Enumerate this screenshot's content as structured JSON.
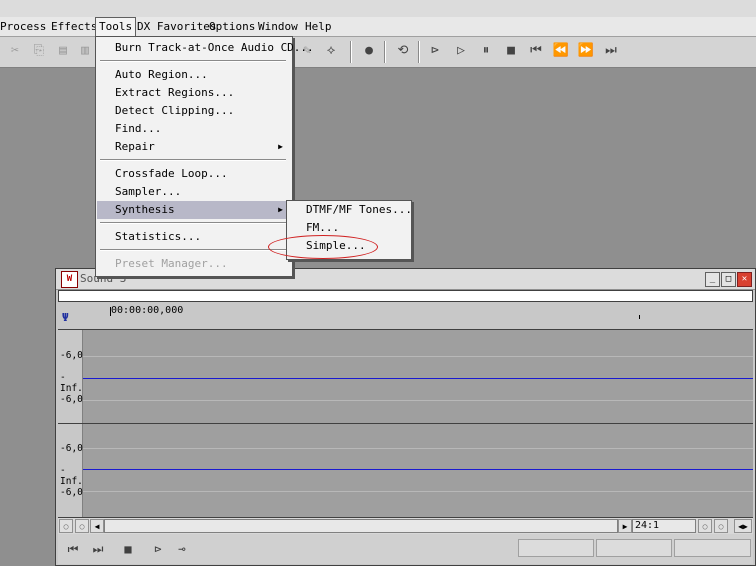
{
  "menu": [
    {
      "label": "Process",
      "active": false
    },
    {
      "label": "Effects",
      "active": false
    },
    {
      "label": "Tools",
      "active": true
    },
    {
      "label": "DX Favorites",
      "active": false
    },
    {
      "label": "Options",
      "active": false
    },
    {
      "label": "Window",
      "active": false
    },
    {
      "label": "Help",
      "active": false
    }
  ],
  "tools_menu": {
    "burn": "Burn Track-at-Once Audio CD...",
    "auto_region": "Auto Region...",
    "extract_regions": "Extract Regions...",
    "detect_clipping": "Detect Clipping...",
    "find": "Find...",
    "repair": "Repair",
    "crossfade_loop": "Crossfade Loop...",
    "sampler": "Sampler...",
    "synthesis": "Synthesis",
    "statistics": "Statistics...",
    "preset_manager": "Preset Manager..."
  },
  "synthesis_submenu": {
    "dtmf": "DTMF/MF Tones...",
    "fm": "FM...",
    "simple": "Simple..."
  },
  "sound_window": {
    "title": "Sound 3",
    "timecode": "00:00:00,000",
    "zoom": "24:1",
    "channel1_labels": [
      "-6,0",
      "-Inf.",
      "-6,0"
    ],
    "channel2_labels": [
      "-6,0",
      "-Inf.",
      "-6,0"
    ]
  },
  "colors": {
    "highlight": "#b8b8c8",
    "waveform_line": "#1a1ad0",
    "annotation": "#d02020"
  }
}
